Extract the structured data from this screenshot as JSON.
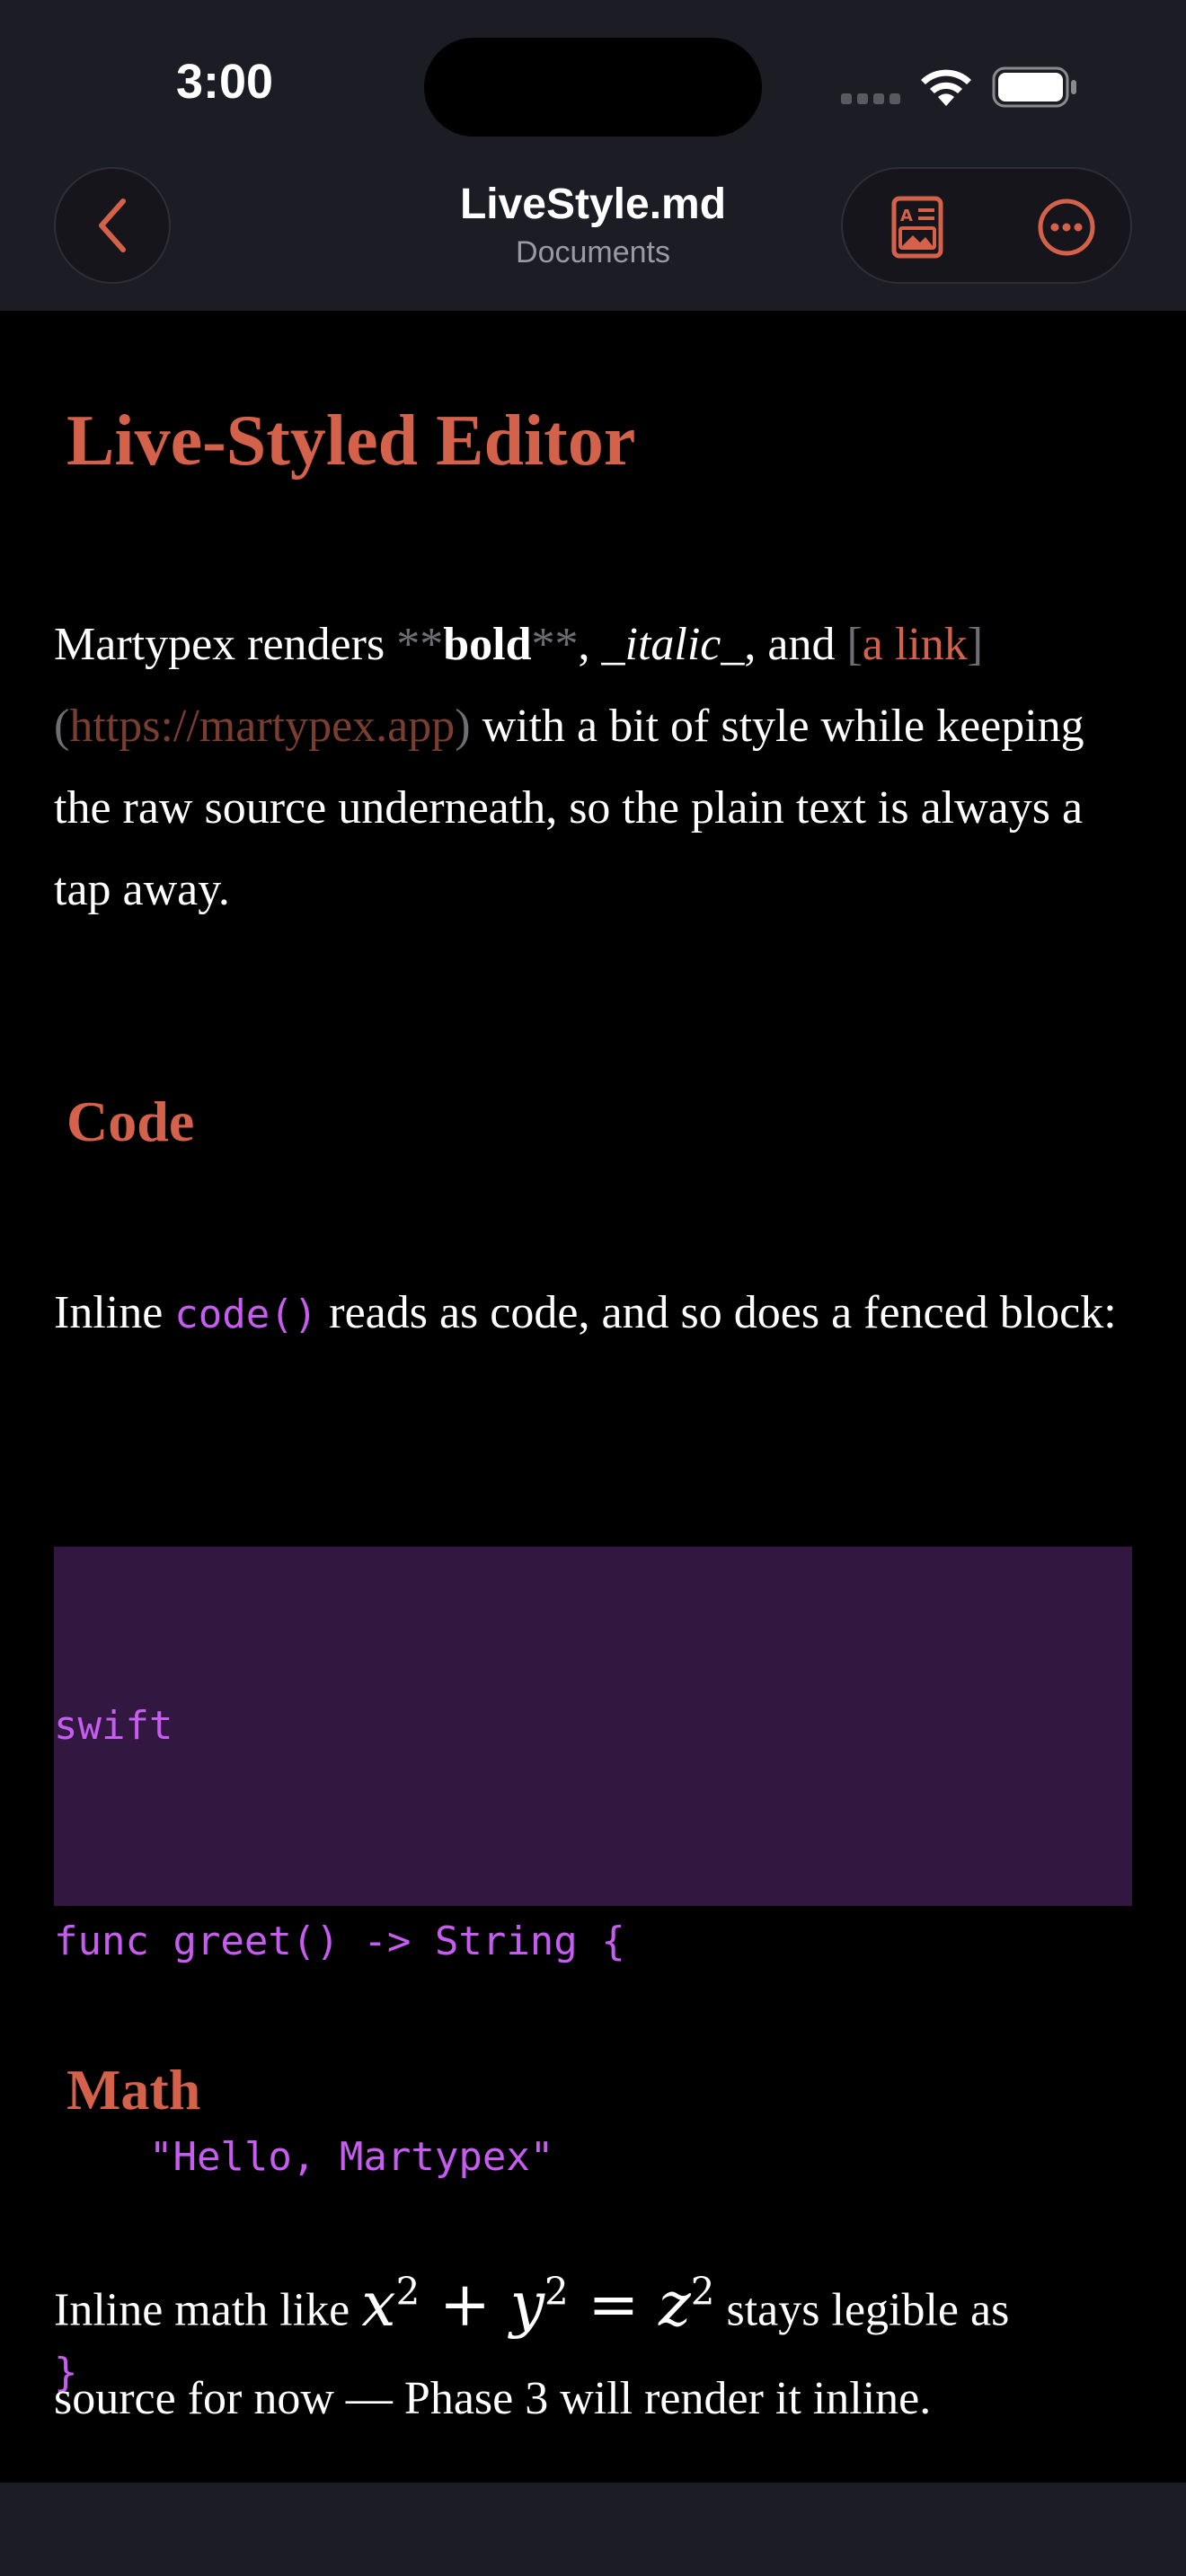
{
  "status": {
    "time": "3:00"
  },
  "nav": {
    "title": "LiveStyle.md",
    "subtitle": "Documents",
    "icons": {
      "back": "chevron-left-icon",
      "reader": "reader-mode-icon",
      "more": "ellipsis-circle-icon"
    }
  },
  "colors": {
    "accent": "#d4614a",
    "code": "#c65cf0",
    "code_bg": "#321840",
    "bar_bg": "#1c1c24"
  },
  "doc": {
    "h1": "Live-Styled Editor",
    "p1": {
      "a": "Martypex renders ",
      "bold_mk1": "**",
      "bold": "bold",
      "bold_mk2": "**",
      "b": ", ",
      "italic": "_italic_",
      "c": ", and ",
      "lb1": "[",
      "link_text": "a link",
      "lb2": "]",
      "pb1": "(",
      "url": "https://martypex.app",
      "pb2": ")",
      "rest": " with a bit of style while keeping the raw source underneath, so the plain text is always a tap away."
    },
    "h2_code": "Code",
    "p2": {
      "a": "Inline ",
      "code": "code()",
      "rest": " reads as code, and so does a fenced block:"
    },
    "codeblock": {
      "lines": [
        "swift",
        "func greet() -> String {",
        "    \"Hello, Martypex\"",
        "}"
      ]
    },
    "h2_math": "Math",
    "p3": {
      "a": "Inline math like ",
      "math_x": "x",
      "math_y": "y",
      "math_z": "z",
      "exp": "2",
      "plus": " + ",
      "eq": " = ",
      "rest": " stays legible as source for now — Phase 3 will render it inline."
    }
  }
}
